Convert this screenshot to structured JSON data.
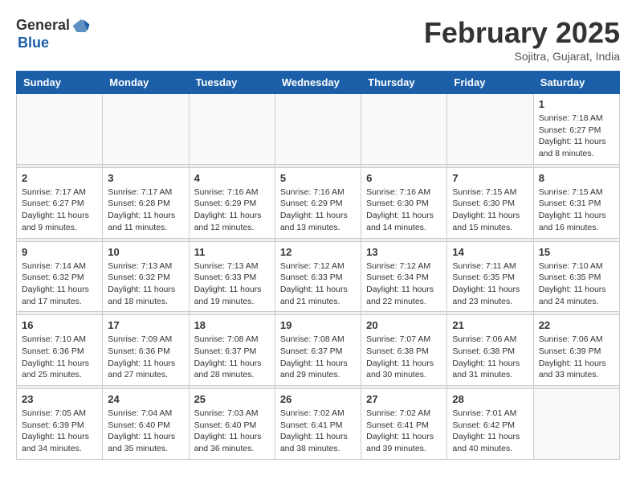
{
  "logo": {
    "general": "General",
    "blue": "Blue"
  },
  "header": {
    "title": "February 2025",
    "subtitle": "Sojitra, Gujarat, India"
  },
  "weekdays": [
    "Sunday",
    "Monday",
    "Tuesday",
    "Wednesday",
    "Thursday",
    "Friday",
    "Saturday"
  ],
  "weeks": [
    [
      {
        "day": "",
        "info": ""
      },
      {
        "day": "",
        "info": ""
      },
      {
        "day": "",
        "info": ""
      },
      {
        "day": "",
        "info": ""
      },
      {
        "day": "",
        "info": ""
      },
      {
        "day": "",
        "info": ""
      },
      {
        "day": "1",
        "info": "Sunrise: 7:18 AM\nSunset: 6:27 PM\nDaylight: 11 hours and 8 minutes."
      }
    ],
    [
      {
        "day": "2",
        "info": "Sunrise: 7:17 AM\nSunset: 6:27 PM\nDaylight: 11 hours and 9 minutes."
      },
      {
        "day": "3",
        "info": "Sunrise: 7:17 AM\nSunset: 6:28 PM\nDaylight: 11 hours and 11 minutes."
      },
      {
        "day": "4",
        "info": "Sunrise: 7:16 AM\nSunset: 6:29 PM\nDaylight: 11 hours and 12 minutes."
      },
      {
        "day": "5",
        "info": "Sunrise: 7:16 AM\nSunset: 6:29 PM\nDaylight: 11 hours and 13 minutes."
      },
      {
        "day": "6",
        "info": "Sunrise: 7:16 AM\nSunset: 6:30 PM\nDaylight: 11 hours and 14 minutes."
      },
      {
        "day": "7",
        "info": "Sunrise: 7:15 AM\nSunset: 6:30 PM\nDaylight: 11 hours and 15 minutes."
      },
      {
        "day": "8",
        "info": "Sunrise: 7:15 AM\nSunset: 6:31 PM\nDaylight: 11 hours and 16 minutes."
      }
    ],
    [
      {
        "day": "9",
        "info": "Sunrise: 7:14 AM\nSunset: 6:32 PM\nDaylight: 11 hours and 17 minutes."
      },
      {
        "day": "10",
        "info": "Sunrise: 7:13 AM\nSunset: 6:32 PM\nDaylight: 11 hours and 18 minutes."
      },
      {
        "day": "11",
        "info": "Sunrise: 7:13 AM\nSunset: 6:33 PM\nDaylight: 11 hours and 19 minutes."
      },
      {
        "day": "12",
        "info": "Sunrise: 7:12 AM\nSunset: 6:33 PM\nDaylight: 11 hours and 21 minutes."
      },
      {
        "day": "13",
        "info": "Sunrise: 7:12 AM\nSunset: 6:34 PM\nDaylight: 11 hours and 22 minutes."
      },
      {
        "day": "14",
        "info": "Sunrise: 7:11 AM\nSunset: 6:35 PM\nDaylight: 11 hours and 23 minutes."
      },
      {
        "day": "15",
        "info": "Sunrise: 7:10 AM\nSunset: 6:35 PM\nDaylight: 11 hours and 24 minutes."
      }
    ],
    [
      {
        "day": "16",
        "info": "Sunrise: 7:10 AM\nSunset: 6:36 PM\nDaylight: 11 hours and 25 minutes."
      },
      {
        "day": "17",
        "info": "Sunrise: 7:09 AM\nSunset: 6:36 PM\nDaylight: 11 hours and 27 minutes."
      },
      {
        "day": "18",
        "info": "Sunrise: 7:08 AM\nSunset: 6:37 PM\nDaylight: 11 hours and 28 minutes."
      },
      {
        "day": "19",
        "info": "Sunrise: 7:08 AM\nSunset: 6:37 PM\nDaylight: 11 hours and 29 minutes."
      },
      {
        "day": "20",
        "info": "Sunrise: 7:07 AM\nSunset: 6:38 PM\nDaylight: 11 hours and 30 minutes."
      },
      {
        "day": "21",
        "info": "Sunrise: 7:06 AM\nSunset: 6:38 PM\nDaylight: 11 hours and 31 minutes."
      },
      {
        "day": "22",
        "info": "Sunrise: 7:06 AM\nSunset: 6:39 PM\nDaylight: 11 hours and 33 minutes."
      }
    ],
    [
      {
        "day": "23",
        "info": "Sunrise: 7:05 AM\nSunset: 6:39 PM\nDaylight: 11 hours and 34 minutes."
      },
      {
        "day": "24",
        "info": "Sunrise: 7:04 AM\nSunset: 6:40 PM\nDaylight: 11 hours and 35 minutes."
      },
      {
        "day": "25",
        "info": "Sunrise: 7:03 AM\nSunset: 6:40 PM\nDaylight: 11 hours and 36 minutes."
      },
      {
        "day": "26",
        "info": "Sunrise: 7:02 AM\nSunset: 6:41 PM\nDaylight: 11 hours and 38 minutes."
      },
      {
        "day": "27",
        "info": "Sunrise: 7:02 AM\nSunset: 6:41 PM\nDaylight: 11 hours and 39 minutes."
      },
      {
        "day": "28",
        "info": "Sunrise: 7:01 AM\nSunset: 6:42 PM\nDaylight: 11 hours and 40 minutes."
      },
      {
        "day": "",
        "info": ""
      }
    ]
  ]
}
